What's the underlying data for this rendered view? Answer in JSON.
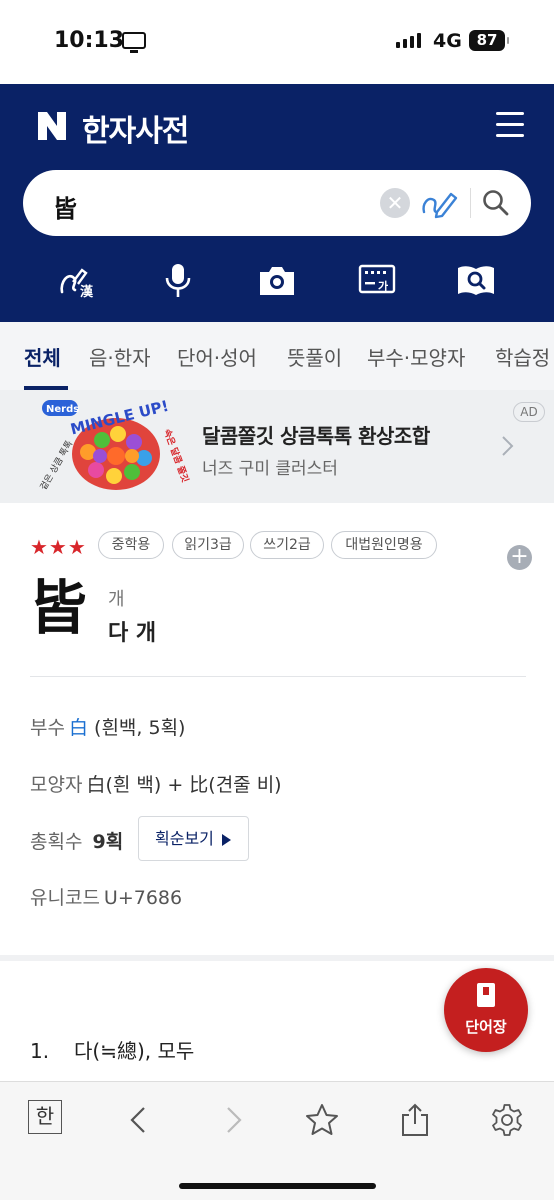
{
  "status_bar": {
    "time": "10:13",
    "network": "4G",
    "battery": "87"
  },
  "header": {
    "logo": "N",
    "title": "한자사전"
  },
  "search": {
    "query": "皆"
  },
  "tools": [
    "hanja-handwriting-icon",
    "microphone-icon",
    "camera-icon",
    "keyboard-icon",
    "book-search-icon"
  ],
  "tabs": [
    {
      "label": "전체",
      "active": true
    },
    {
      "label": "음·한자"
    },
    {
      "label": "단어·성어"
    },
    {
      "label": "뜻풀이"
    },
    {
      "label": "부수·모양자"
    },
    {
      "label": "학습정"
    }
  ],
  "ad": {
    "title": "달콤쫄깃 상큼톡톡 환상조합",
    "subtitle": "너즈 구미 클러스터",
    "badge": "AD",
    "image_text": {
      "brand": "Nerds",
      "headline": "MINGLE UP!",
      "left": "겉은 상큼 톡톡",
      "right": "속은 달콤 쫄깃"
    }
  },
  "entry": {
    "stars": "★★★",
    "tags": [
      "중학용",
      "읽기3급",
      "쓰기2급",
      "대법원인명용"
    ],
    "character": "皆",
    "reading": "개",
    "meaning": "다 개",
    "radical_label": "부수",
    "radical_char": "白",
    "radical_desc": "(흰백, 5획)",
    "shape_label": "모양자",
    "shape_value": "白(흰 백) + 比(견줄 비)",
    "strokes_label": "총획수",
    "strokes_value": "9획",
    "stroke_order_button": "획순보기",
    "unicode_label": "유니코드",
    "unicode_value": "U+7686"
  },
  "definitions": [
    {
      "num": "1.",
      "text": "다(≒總), 모두"
    }
  ],
  "fab": {
    "label": "단어장"
  },
  "browser_bar": {
    "hangul_key": "한"
  }
}
